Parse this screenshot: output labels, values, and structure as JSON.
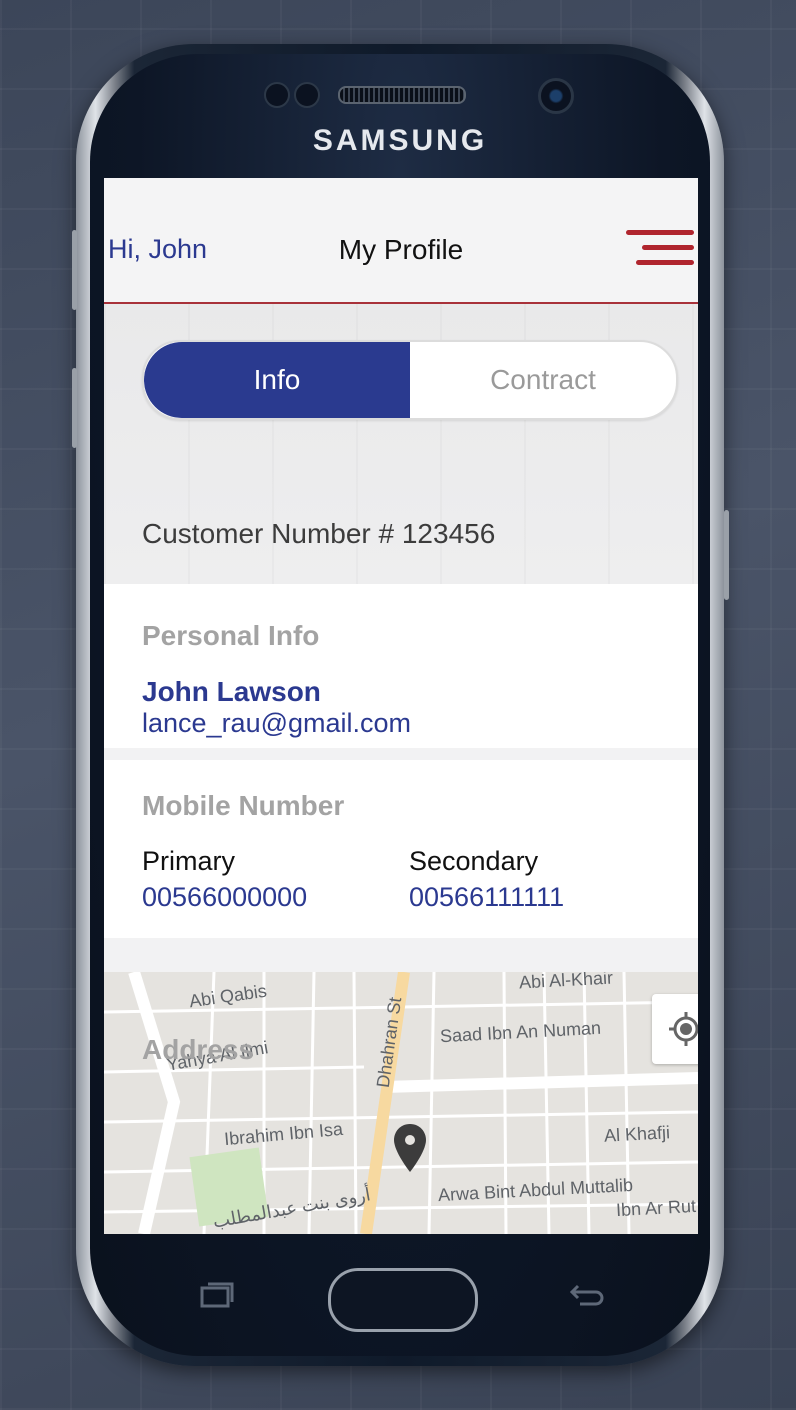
{
  "device": {
    "brand": "SAMSUNG"
  },
  "header": {
    "greeting": "Hi, John",
    "title": "My Profile",
    "menu_icon": "hamburger-menu-icon",
    "accent_color": "#b0252e"
  },
  "tabs": [
    {
      "label": "Info",
      "active": true
    },
    {
      "label": "Contract",
      "active": false
    }
  ],
  "customer": {
    "number_text": "Customer Number # 123456"
  },
  "personal_info": {
    "label": "Personal Info",
    "name": "John Lawson",
    "email": "lance_rau@gmail.com"
  },
  "mobile": {
    "label": "Mobile Number",
    "primary_label": "Primary",
    "primary_value": "00566000000",
    "secondary_label": "Secondary",
    "secondary_value": "00566111111"
  },
  "address": {
    "label": "Address",
    "streets": [
      "Abi Al-Khair",
      "Abi Qabis",
      "Dhahran St",
      "Saad Ibn An Numan",
      "Yahya Al Ilmi",
      "Ibrahim Ibn Isa",
      "Al Khafji",
      "Arwa Bint Abdul Muttalib",
      "Ibn Ar Rut",
      "أروى بنت عبدالمطلب"
    ],
    "pin_icon": "map-pin-icon",
    "locate_icon": "my-location-icon"
  },
  "colors": {
    "primary": "#2a3a8f",
    "brand_blue": "#2b3990",
    "muted": "#a3a3a3"
  }
}
